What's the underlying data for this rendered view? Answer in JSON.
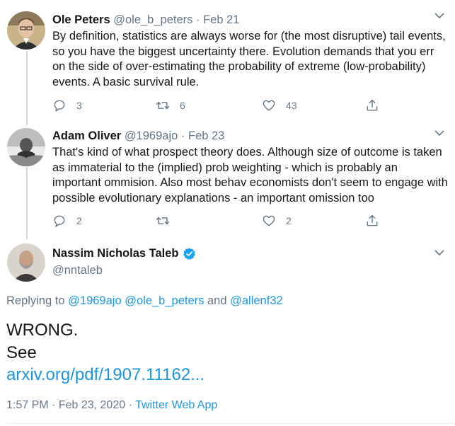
{
  "thread": [
    {
      "name": "Ole Peters",
      "handle": "@ole_b_peters",
      "separator": "·",
      "date": "Feb 21",
      "avatar_icon": "user-avatar-portrait",
      "text": "By definition, statistics are always worse for (the most disruptive) tail events, so you have the biggest uncertainty there. Evolution demands that you err on the side of over-estimating the probability of extreme (low-probability) events. A basic survival rule.",
      "replies": "3",
      "retweets": "6",
      "likes": "43"
    },
    {
      "name": "Adam Oliver",
      "handle": "@1969ajo",
      "separator": "·",
      "date": "Feb 23",
      "avatar_icon": "user-avatar-grayscale",
      "text": "That's kind of what prospect theory does. Although size of outcome is taken as immaterial to the (implied) prob weighting - which is probably an important ommision. Also most behav economists don't seem to engage with possible evolutionary explanations - an important omission too",
      "replies": "2",
      "retweets": "",
      "likes": "2"
    }
  ],
  "main_tweet": {
    "name": "Nassim Nicholas Taleb",
    "handle": "@nntaleb",
    "verified_icon": "verified-badge-icon",
    "replying_prefix": "Replying to",
    "replying_to": [
      "@1969ajo",
      "@ole_b_peters"
    ],
    "replying_and": "and",
    "replying_last": "@allenf32",
    "line1": "WRONG.",
    "line2": "See",
    "link": "arxiv.org/pdf/1907.11162...",
    "time": "1:57 PM",
    "meta_sep": "·",
    "date": "Feb 23, 2020",
    "source": "Twitter Web App"
  },
  "colors": {
    "link": "#1b95e0",
    "secondary": "#657786",
    "verified": "#1da1f2",
    "thread_line": "#ccd6dd"
  }
}
